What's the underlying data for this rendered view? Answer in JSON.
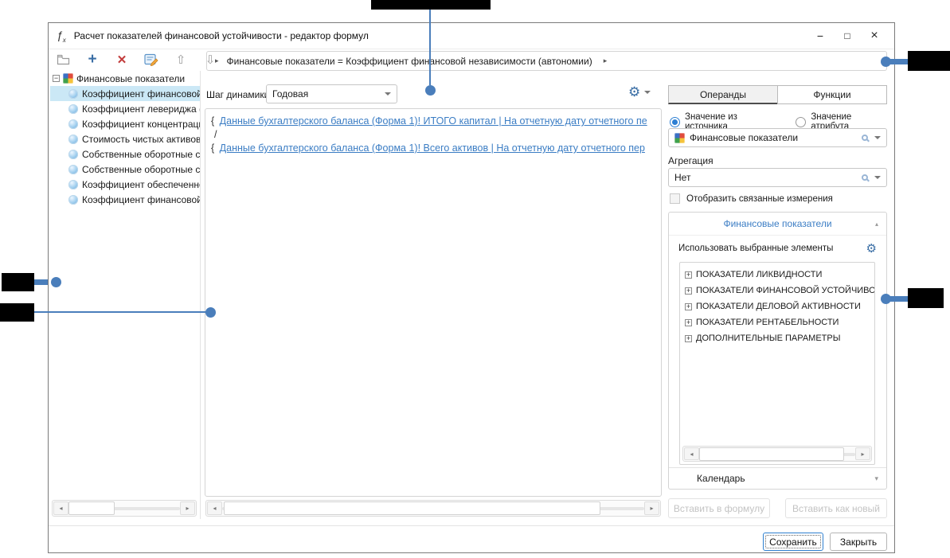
{
  "window": {
    "title": "Расчет показателей финансовой устойчивости - редактор формул",
    "minimize_glyph": "−",
    "maximize_glyph": "□",
    "close_glyph": "×"
  },
  "formula_bar": {
    "text": "Финансовые показатели = Коэффициент финансовой независимости (автономии)"
  },
  "tree": {
    "root_label": "Финансовые показатели",
    "items": [
      "Коэффициент финансовой",
      "Коэффициент левериджа (",
      "Коэффициент концентраци",
      "Стоимость чистых активов",
      "Собственные оборотные с",
      "Собственные оборотные с",
      "Коэффициент обеспеченно",
      "Коэффициент финансовой"
    ]
  },
  "editor": {
    "dynamics_label": "Шаг динамики",
    "dynamics_value": "Годовая",
    "lines": [
      {
        "brace": "{",
        "link": "Данные бухгалтерского баланса (Форма 1)! ИТОГО капитал | На отчетную дату отчетного пе"
      },
      {
        "plain": "/"
      },
      {
        "brace": "{",
        "link": "Данные бухгалтерского баланса (Форма 1)! Всего активов | На отчетную дату отчетного пер"
      }
    ]
  },
  "operands": {
    "tab_operands": "Операнды",
    "tab_functions": "Функции",
    "radio_source": "Значение из источника",
    "radio_attribute": "Значение атрибута",
    "source_value": "Финансовые показатели",
    "aggregation_label": "Агрегация",
    "aggregation_value": "Нет",
    "checkbox_label": "Отобразить связанные измерения",
    "section_title": "Финансовые показатели",
    "use_selected_label": "Использовать выбранные элементы",
    "tree_items": [
      "ПОКАЗАТЕЛИ ЛИКВИДНОСТИ",
      "ПОКАЗАТЕЛИ ФИНАНСОВОЙ УСТОЙЧИВОСТИ",
      "ПОКАЗАТЕЛИ ДЕЛОВОЙ АКТИВНОСТИ",
      "ПОКАЗАТЕЛИ РЕНТАБЕЛЬНОСТИ",
      "ДОПОЛНИТЕЛЬНЫЕ ПАРАМЕТРЫ"
    ],
    "calendar_label": "Календарь",
    "insert_formula_label": "Вставить в формулу",
    "insert_new_label": "Вставить как новый"
  },
  "footer": {
    "save_label": "Сохранить",
    "close_label": "Закрыть"
  },
  "colors": {
    "accent_blue": "#3a6ea5",
    "link_blue": "#3b7dc4",
    "selection": "#cbe8f6",
    "annotation_line": "#4a7ebb",
    "annotation_box": "#000000",
    "danger_red": "#c23b3b",
    "disabled_text": "#c3c3c3"
  }
}
